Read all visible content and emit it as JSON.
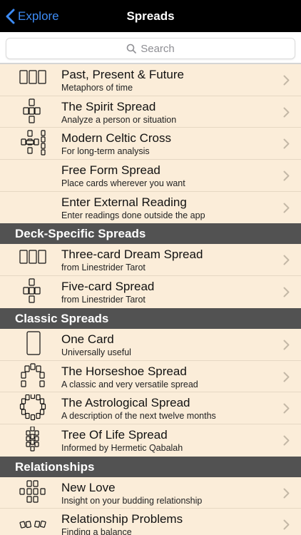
{
  "nav": {
    "back_label": "Explore",
    "title": "Spreads"
  },
  "search": {
    "placeholder": "Search"
  },
  "top_items": [
    {
      "title": "Past, Present & Future",
      "subtitle": "Metaphors of time",
      "icon": "three-card-icon"
    },
    {
      "title": "The Spirit Spread",
      "subtitle": "Analyze a person or situation",
      "icon": "cross-spread-icon"
    },
    {
      "title": "Modern Celtic Cross",
      "subtitle": "For long-term analysis",
      "icon": "celtic-cross-icon"
    },
    {
      "title": "Free Form Spread",
      "subtitle": "Place cards wherever you want",
      "icon": ""
    },
    {
      "title": "Enter External Reading",
      "subtitle": "Enter readings done outside the app",
      "icon": ""
    }
  ],
  "sections": [
    {
      "header": "Deck-Specific Spreads",
      "items": [
        {
          "title": "Three-card Dream Spread",
          "subtitle": "from Linestrider Tarot",
          "icon": "three-card-icon"
        },
        {
          "title": "Five-card Spread",
          "subtitle": "from Linestrider Tarot",
          "icon": "cross-spread-icon"
        }
      ]
    },
    {
      "header": "Classic Spreads",
      "items": [
        {
          "title": "One Card",
          "subtitle": "Universally useful",
          "icon": "single-card-icon"
        },
        {
          "title": "The Horseshoe Spread",
          "subtitle": "A classic and very versatile spread",
          "icon": "horseshoe-icon"
        },
        {
          "title": "The Astrological Spread",
          "subtitle": "A description of the next twelve months",
          "icon": "circle-spread-icon"
        },
        {
          "title": "Tree Of Life Spread",
          "subtitle": "Informed by Hermetic Qabalah",
          "icon": "tree-of-life-icon"
        }
      ]
    },
    {
      "header": "Relationships",
      "items": [
        {
          "title": "New Love",
          "subtitle": "Insight on your budding relationship",
          "icon": "new-love-icon"
        },
        {
          "title": "Relationship Problems",
          "subtitle": "Finding a balance",
          "icon": "relationship-icon"
        }
      ]
    }
  ],
  "colors": {
    "nav_bg": "#000000",
    "accent": "#3d8cf6",
    "list_bg": "#fbedd9",
    "section_bg": "#525252"
  }
}
